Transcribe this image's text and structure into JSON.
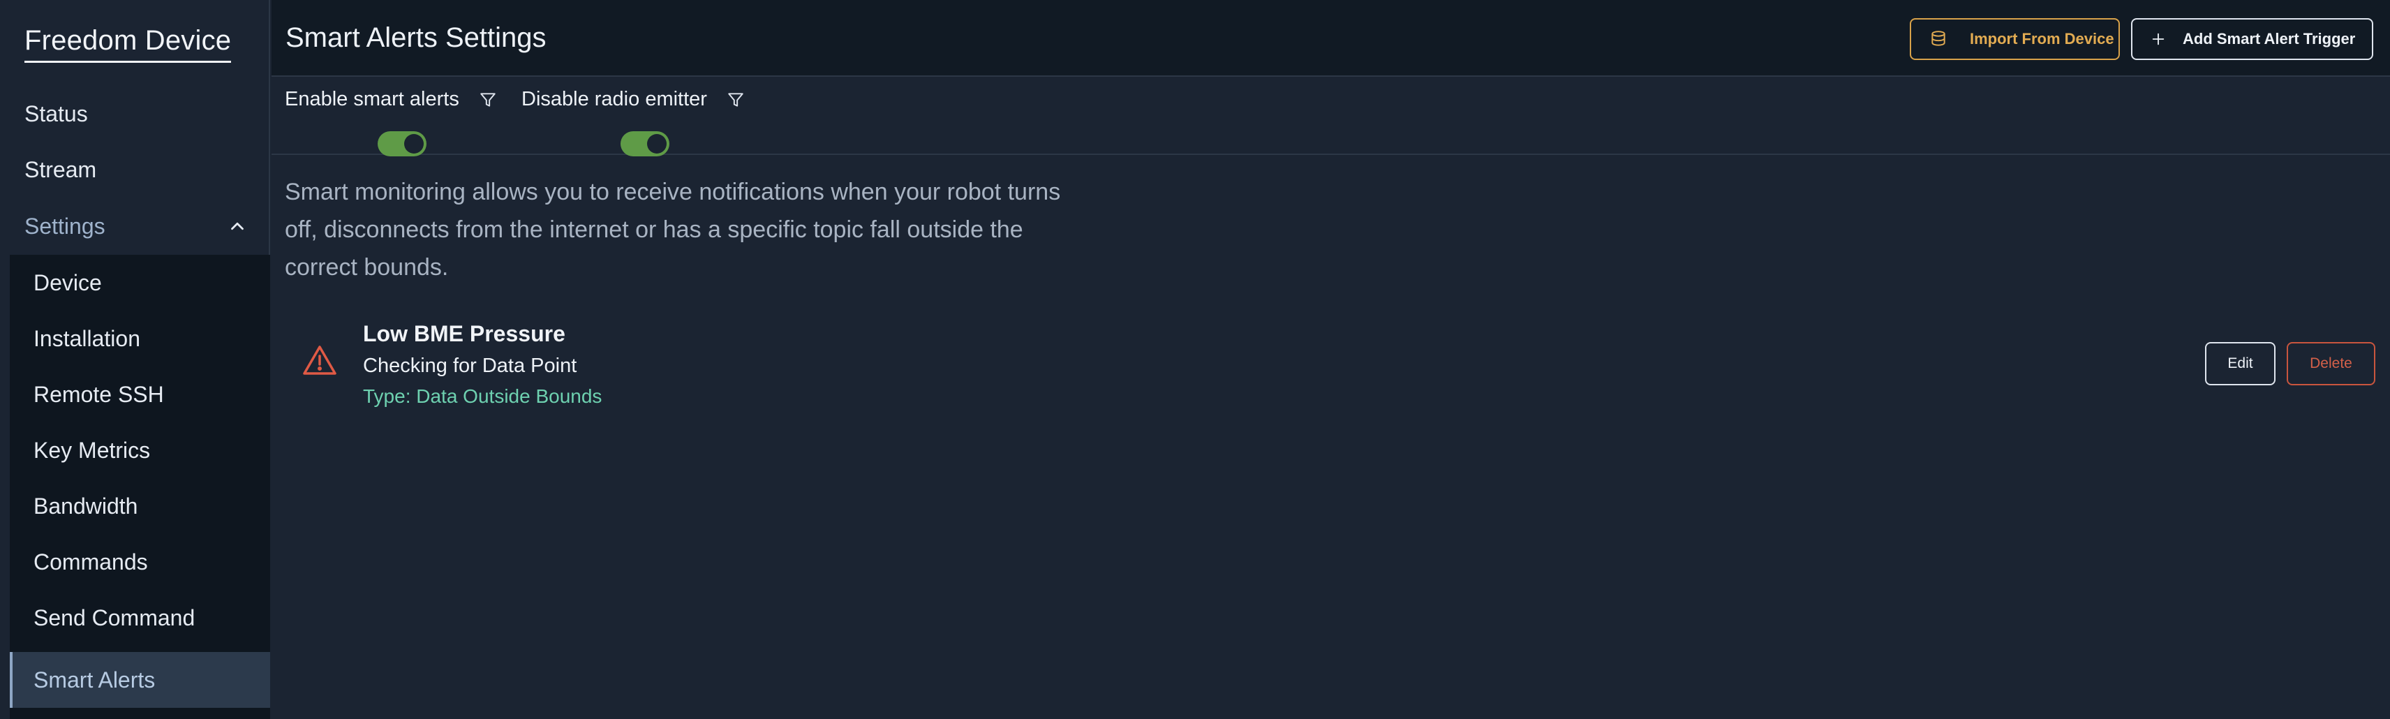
{
  "sidebar": {
    "brand": "Freedom Device",
    "items": [
      {
        "label": "Status"
      },
      {
        "label": "Stream"
      }
    ],
    "settings": {
      "label": "Settings",
      "icon": "chevron-up-icon",
      "subitems": [
        {
          "label": "Device"
        },
        {
          "label": "Installation"
        },
        {
          "label": "Remote SSH"
        },
        {
          "label": "Key Metrics"
        },
        {
          "label": "Bandwidth"
        },
        {
          "label": "Commands"
        },
        {
          "label": "Send Command"
        },
        {
          "label": "Smart Alerts",
          "active": true
        }
      ]
    }
  },
  "header": {
    "title": "Smart Alerts Settings",
    "import_button": {
      "label": "Import From Device",
      "icon": "database-icon"
    },
    "add_button": {
      "label": "Add Smart Alert Trigger",
      "icon": "plus-icon"
    }
  },
  "toggles": [
    {
      "label": "Enable smart alerts",
      "on": true,
      "icon": "filter-icon"
    },
    {
      "label": "Disable radio emitter",
      "on": true,
      "icon": "filter-icon"
    }
  ],
  "description": "Smart monitoring allows you to receive notifications when your robot turns off, disconnects from the internet or has a specific topic fall outside the correct bounds.",
  "alerts": [
    {
      "icon": "warning-icon",
      "title": "Low BME Pressure",
      "subtitle": "Checking for Data Point",
      "type": "Type: Data Outside Bounds",
      "edit_label": "Edit",
      "delete_label": "Delete"
    }
  ],
  "colors": {
    "background": "#1b2432",
    "header_bg": "#111a24",
    "submenu_bg": "#0e161f",
    "toggle_on": "#5f9b47",
    "import_accent": "#e3ac52",
    "type_text": "#6ed1b0",
    "warning": "#e05a45",
    "delete": "#d46049"
  }
}
